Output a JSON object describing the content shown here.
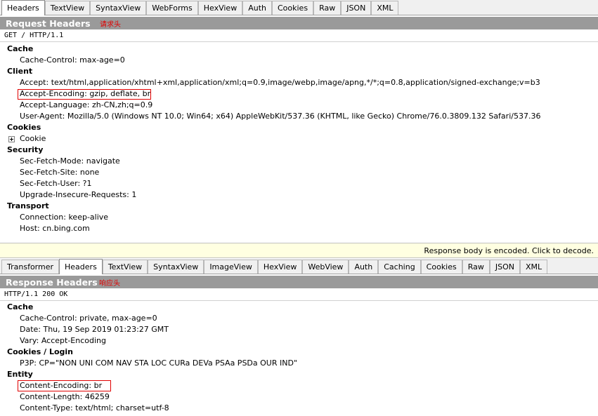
{
  "request_tabs": [
    "Headers",
    "TextView",
    "SyntaxView",
    "WebForms",
    "HexView",
    "Auth",
    "Cookies",
    "Raw",
    "JSON",
    "XML"
  ],
  "request_section": {
    "title": "Request Headers",
    "annotation": "请求头",
    "request_line": "GET / HTTP/1.1"
  },
  "request_groups": {
    "cache": {
      "name": "Cache",
      "headers": [
        "Cache-Control: max-age=0"
      ]
    },
    "client": {
      "name": "Client",
      "headers": [
        "Accept: text/html,application/xhtml+xml,application/xml;q=0.9,image/webp,image/apng,*/*;q=0.8,application/signed-exchange;v=b3",
        "Accept-Encoding: gzip, deflate, br",
        "Accept-Language: zh-CN,zh;q=0.9",
        "User-Agent: Mozilla/5.0 (Windows NT 10.0; Win64; x64) AppleWebKit/537.36 (KHTML, like Gecko) Chrome/76.0.3809.132 Safari/537.36"
      ]
    },
    "cookies": {
      "name": "Cookies",
      "items": [
        "Cookie"
      ]
    },
    "security": {
      "name": "Security",
      "headers": [
        "Sec-Fetch-Mode: navigate",
        "Sec-Fetch-Site: none",
        "Sec-Fetch-User: ?1",
        "Upgrade-Insecure-Requests: 1"
      ]
    },
    "transport": {
      "name": "Transport",
      "headers": [
        "Connection: keep-alive",
        "Host: cn.bing.com"
      ]
    }
  },
  "notice": "Response body is encoded. Click to decode.",
  "response_tabs": [
    "Transformer",
    "Headers",
    "TextView",
    "SyntaxView",
    "ImageView",
    "HexView",
    "WebView",
    "Auth",
    "Caching",
    "Cookies",
    "Raw",
    "JSON",
    "XML"
  ],
  "response_section": {
    "title": "Response Headers",
    "annotation": "响应头",
    "status_line": "HTTP/1.1 200 OK"
  },
  "response_groups": {
    "cache": {
      "name": "Cache",
      "headers": [
        "Cache-Control: private, max-age=0",
        "Date: Thu, 19 Sep 2019 01:23:27 GMT",
        "Vary: Accept-Encoding"
      ]
    },
    "cookies_login": {
      "name": "Cookies / Login",
      "headers": [
        "P3P: CP=\"NON UNI COM NAV STA LOC CURa DEVa PSAa PSDa OUR IND\""
      ]
    },
    "entity": {
      "name": "Entity",
      "headers": [
        "Content-Encoding: br",
        "Content-Length: 46259",
        "Content-Type: text/html; charset=utf-8"
      ]
    }
  },
  "colors": {
    "section_header_bg": "#9a9a9a",
    "annotation": "#e00000",
    "highlight_box": "#e00000",
    "notice_bg": "#ffffe1"
  }
}
